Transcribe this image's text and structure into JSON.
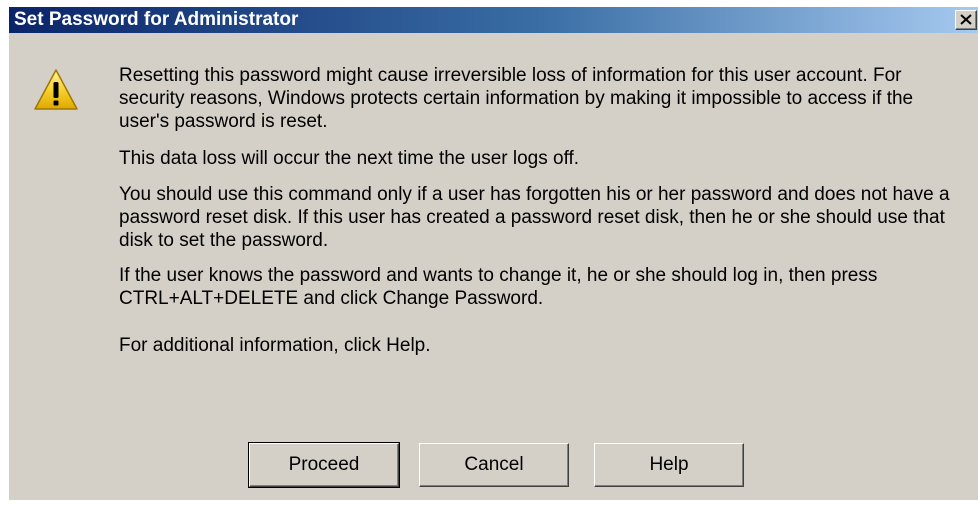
{
  "window": {
    "title": "Set Password for Administrator",
    "close_label": "X"
  },
  "icon": {
    "name": "warning-icon",
    "color": "#f5c518"
  },
  "message": {
    "paragraph1": "Resetting this password might cause irreversible loss of information for this user account. For security reasons, Windows protects certain information by making it impossible to access if the user's password is reset.",
    "paragraph2": "This data loss will occur the next time the user logs off.",
    "paragraph3": "You should use this command only if a user has forgotten his or her password and does not have a password reset disk. If this user has created a password reset disk, then he or she should use that disk to set the password.",
    "paragraph4": "If the user knows the password and wants to change it, he or she should log in, then press CTRL+ALT+DELETE and click Change Password.",
    "paragraph5": "For additional information, click Help."
  },
  "buttons": {
    "proceed": "Proceed",
    "cancel": "Cancel",
    "help": "Help"
  }
}
